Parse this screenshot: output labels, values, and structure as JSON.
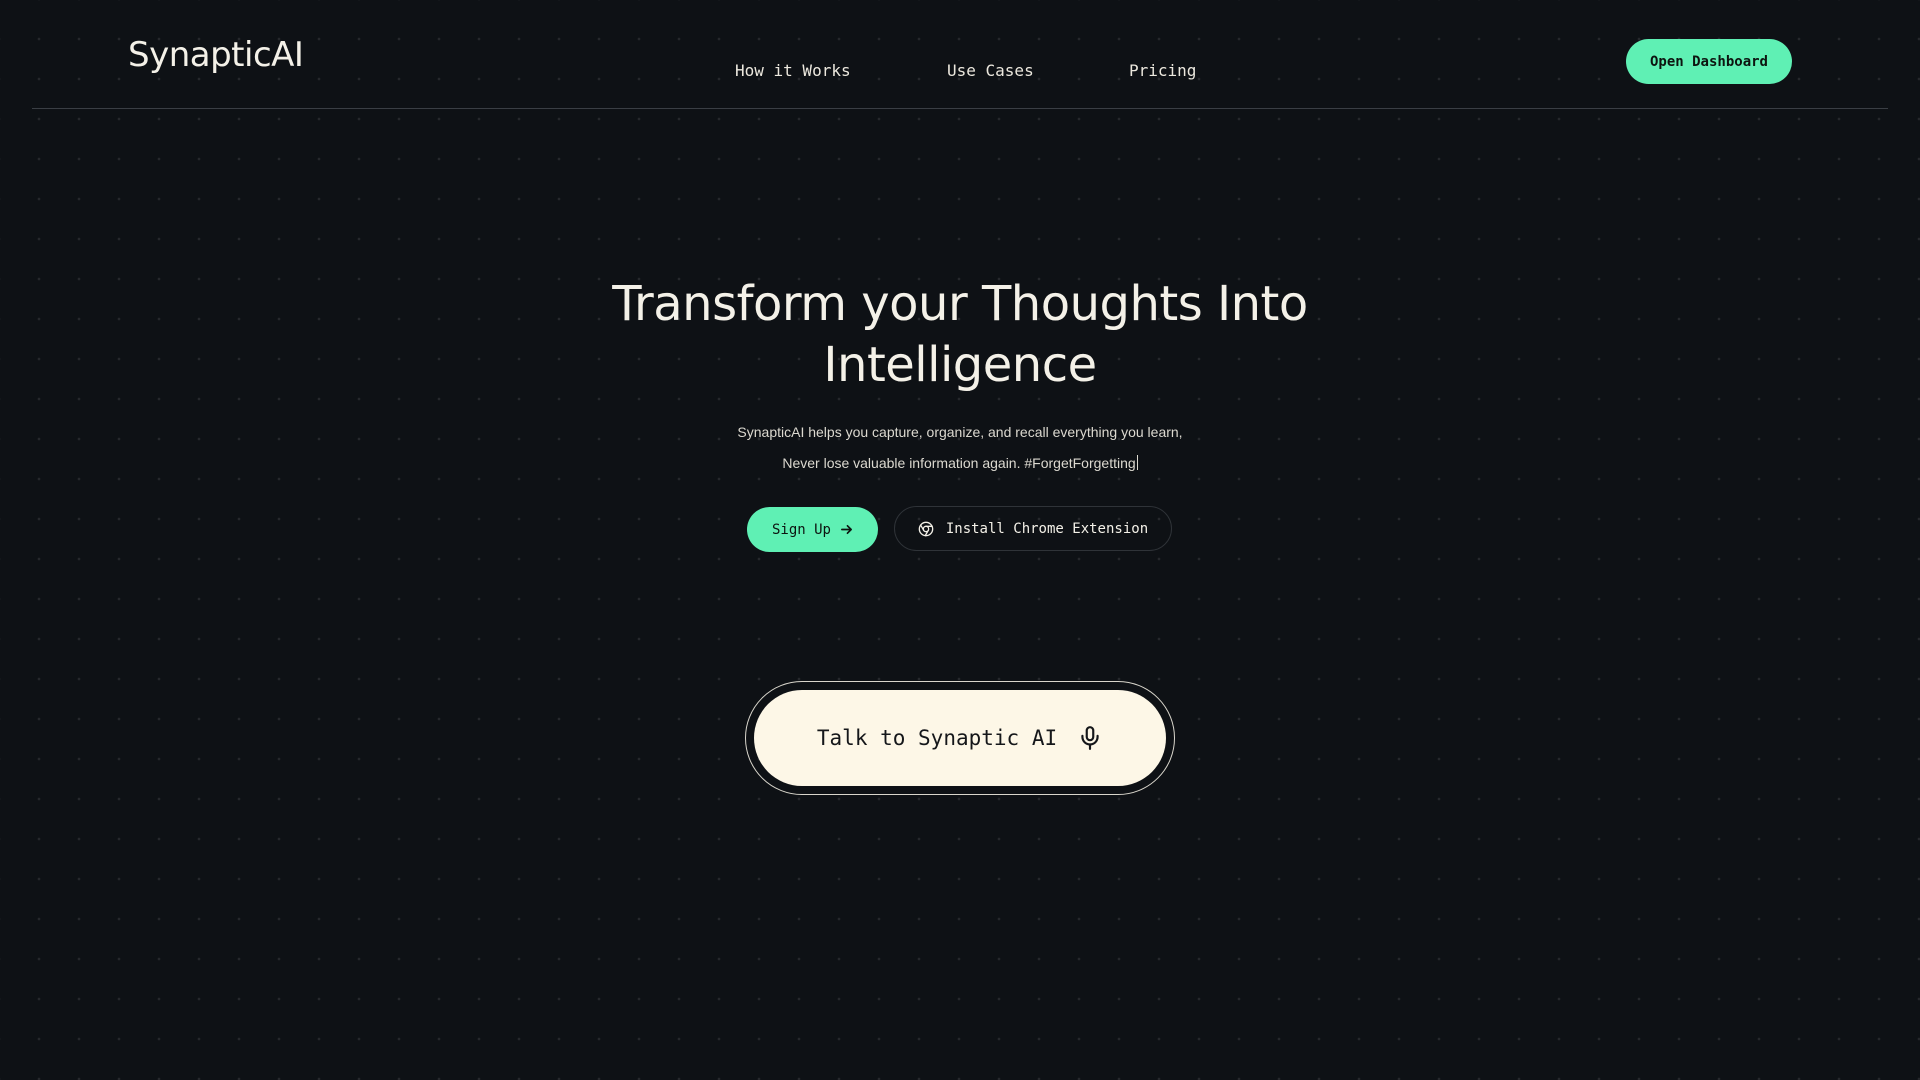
{
  "header": {
    "logo": "SynapticAI",
    "nav": [
      {
        "label": "How it Works"
      },
      {
        "label": "Use Cases"
      },
      {
        "label": "Pricing"
      }
    ],
    "dashboard_button": "Open Dashboard"
  },
  "hero": {
    "title_line1": "Transform your Thoughts Into",
    "title_line2": "Intelligence",
    "subtitle_line1": "SynapticAI helps you capture, organize, and recall everything you learn,",
    "subtitle_line2": "Never lose valuable information again. #ForgetForgetting",
    "signup_button": "Sign Up",
    "signup_icon": "arrow-right-icon",
    "chrome_button": "Install Chrome Extension",
    "chrome_icon": "chrome-icon"
  },
  "talk": {
    "label": "Talk to Synaptic AI",
    "icon": "microphone-icon"
  },
  "colors": {
    "background": "#0e1115",
    "accent": "#5ff0b4",
    "cream": "#fdf7e7",
    "text": "#f4f1e8"
  }
}
